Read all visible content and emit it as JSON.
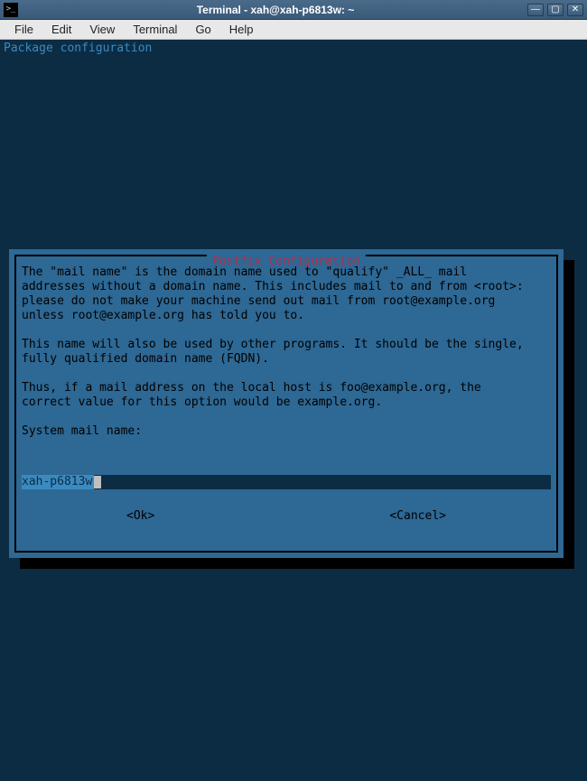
{
  "window": {
    "title": "Terminal - xah@xah-p6813w: ~"
  },
  "menubar": {
    "items": [
      "File",
      "Edit",
      "View",
      "Terminal",
      "Go",
      "Help"
    ]
  },
  "terminal": {
    "header": "Package configuration"
  },
  "dialog": {
    "title": "Postfix Configuration",
    "body": "The \"mail name\" is the domain name used to \"qualify\" _ALL_ mail\naddresses without a domain name. This includes mail to and from <root>:\nplease do not make your machine send out mail from root@example.org\nunless root@example.org has told you to.\n\nThis name will also be used by other programs. It should be the single,\nfully qualified domain name (FQDN).\n\nThus, if a mail address on the local host is foo@example.org, the\ncorrect value for this option would be example.org.\n\nSystem mail name:",
    "input_value": "xah-p6813w",
    "ok_label": "<Ok>",
    "cancel_label": "<Cancel>"
  }
}
